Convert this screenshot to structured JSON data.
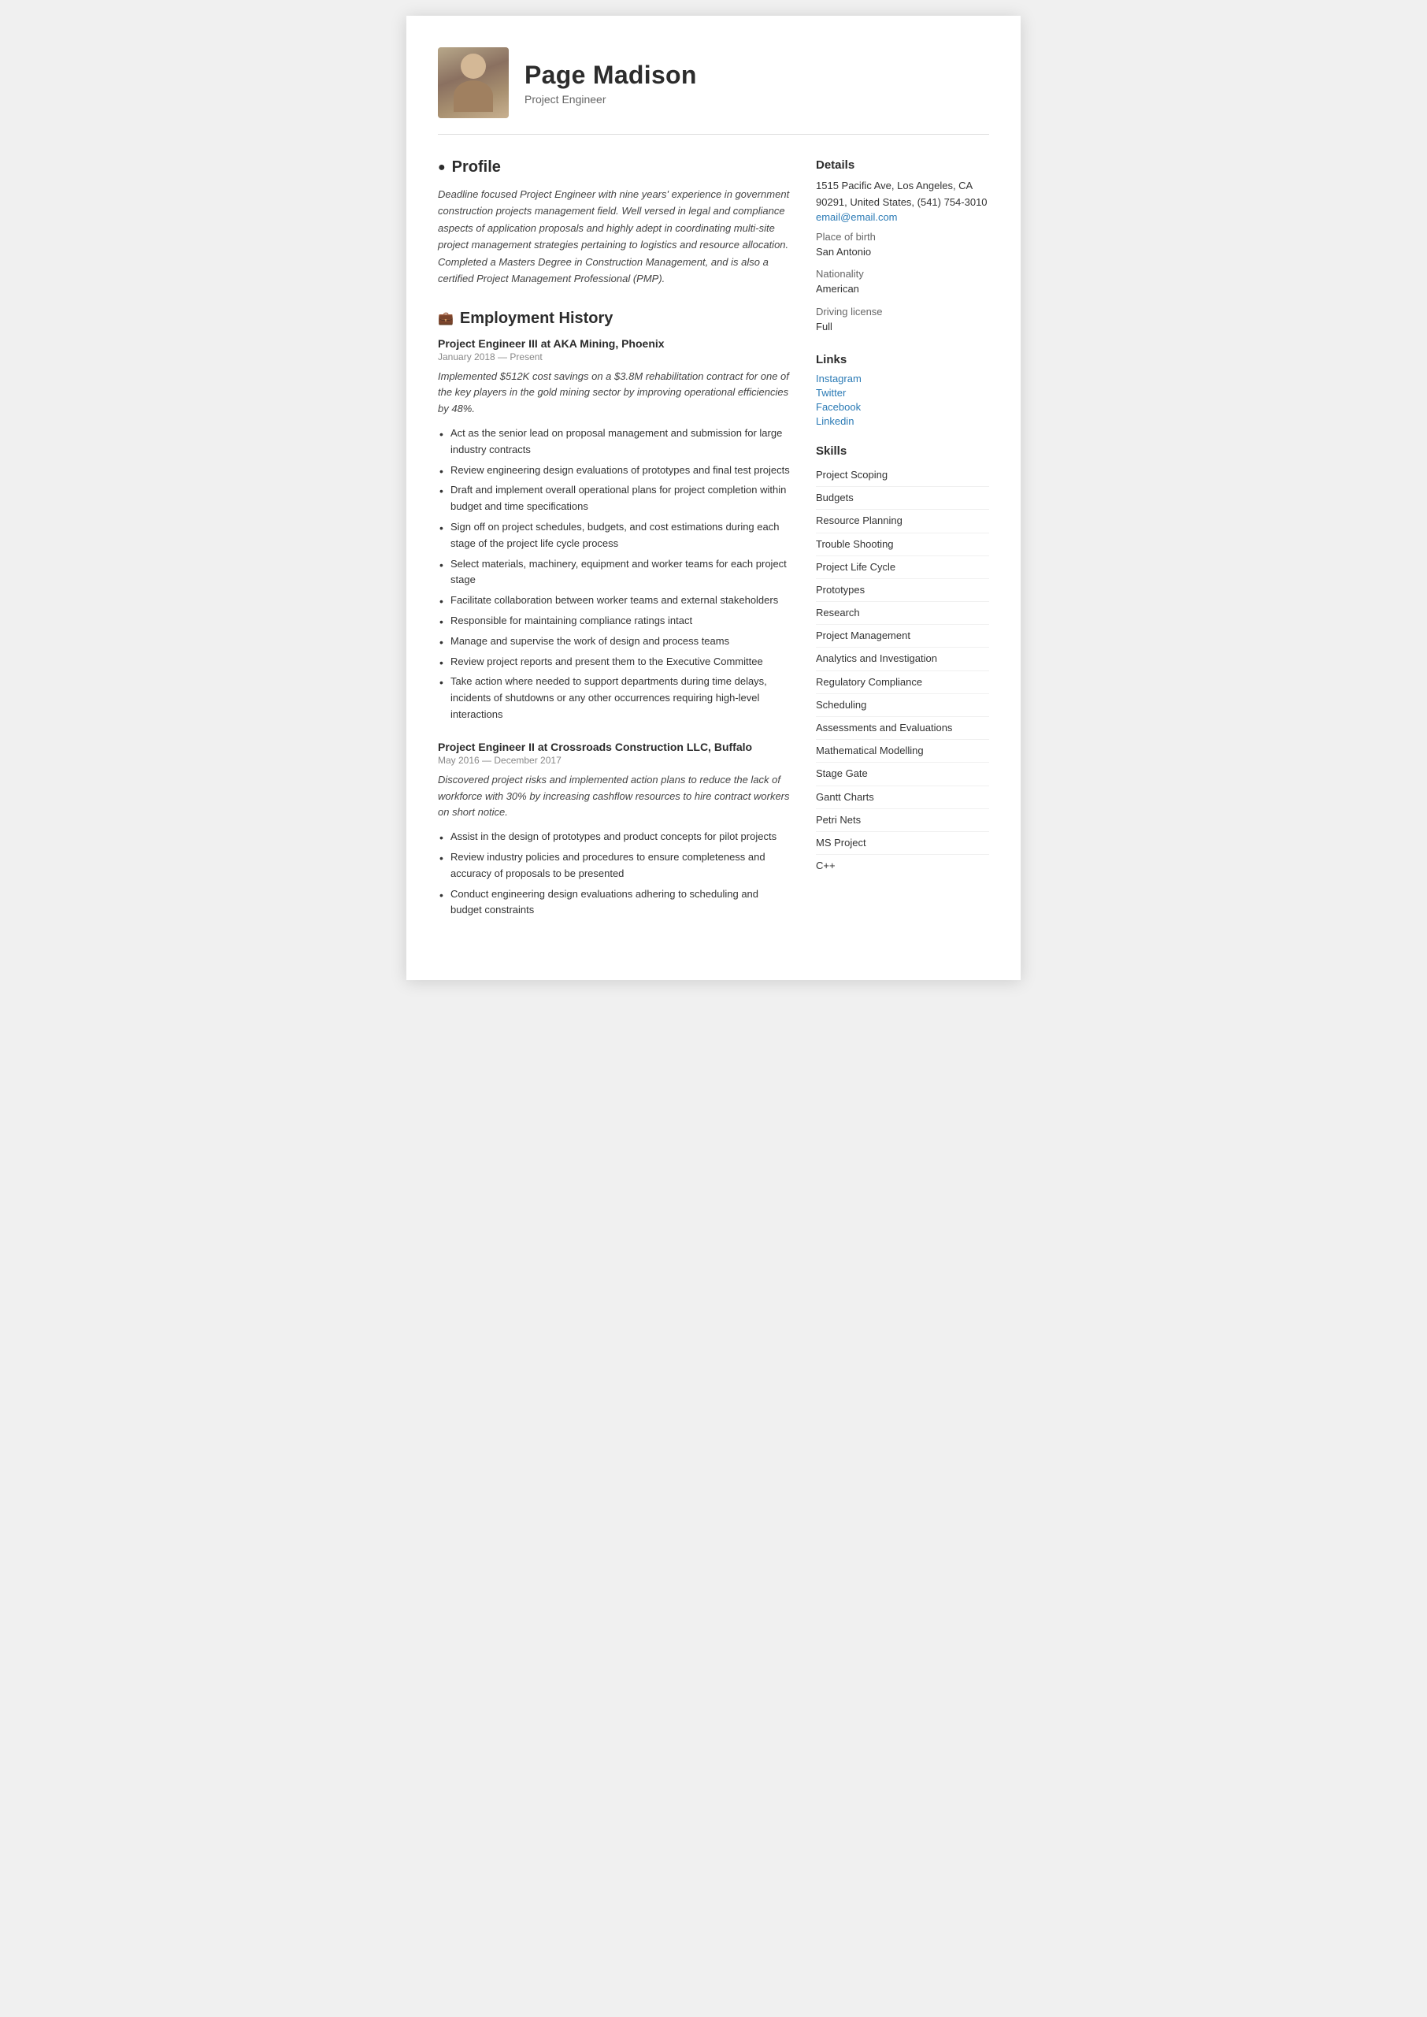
{
  "header": {
    "name": "Page Madison",
    "job_title": "Project Engineer"
  },
  "profile": {
    "section_title": "Profile",
    "text": "Deadline focused Project Engineer with nine years' experience in government construction projects management field. Well versed in legal and compliance aspects of application proposals and highly adept in coordinating multi-site project management strategies pertaining to logistics and resource allocation. Completed a Masters Degree in Construction Management, and is also a certified Project Management Professional (PMP)."
  },
  "employment": {
    "section_title": "Employment History",
    "jobs": [
      {
        "title": "Project Engineer III at  AKA Mining, Phoenix",
        "dates": "January 2018 — Present",
        "summary": "Implemented $512K cost savings on a $3.8M rehabilitation contract for one of the key players in the gold mining sector by improving operational efficiencies by 48%.",
        "bullets": [
          "Act as the senior lead on proposal management and submission for large industry contracts",
          "Review engineering design evaluations of prototypes and final test projects",
          "Draft and implement overall operational plans for project completion within budget and time specifications",
          "Sign off on project schedules, budgets, and cost estimations during each stage of the project life cycle process",
          "Select materials, machinery, equipment and worker teams for each project stage",
          "Facilitate collaboration between worker teams and external stakeholders",
          "Responsible for maintaining compliance ratings intact",
          "Manage and supervise the work of design and process teams",
          "Review project reports and present them to the Executive Committee",
          "Take action where needed to support departments during time delays, incidents of shutdowns or any other occurrences requiring high-level interactions"
        ]
      },
      {
        "title": "Project Engineer II at  Crossroads Construction LLC, Buffalo",
        "dates": "May 2016 — December 2017",
        "summary": "Discovered project risks and implemented action plans to reduce the lack of workforce with 30% by increasing cashflow resources to hire contract workers on short notice.",
        "bullets": [
          "Assist in the design of prototypes and product concepts for pilot projects",
          "Review industry policies and procedures to ensure completeness and accuracy of proposals to be presented",
          "Conduct engineering design evaluations adhering to scheduling and budget constraints"
        ]
      }
    ]
  },
  "details": {
    "section_title": "Details",
    "address": "1515 Pacific Ave, Los Angeles, CA 90291, United States, (541) 754-3010",
    "email": "email@email.com",
    "place_of_birth_label": "Place of birth",
    "place_of_birth": "San Antonio",
    "nationality_label": "Nationality",
    "nationality": "American",
    "driving_license_label": "Driving license",
    "driving_license": "Full"
  },
  "links": {
    "section_title": "Links",
    "items": [
      {
        "label": "Instagram",
        "url": "#"
      },
      {
        "label": "Twitter",
        "url": "#"
      },
      {
        "label": "Facebook",
        "url": "#"
      },
      {
        "label": "Linkedin",
        "url": "#"
      }
    ]
  },
  "skills": {
    "section_title": "Skills",
    "items": [
      "Project Scoping",
      "Budgets",
      "Resource Planning",
      "Trouble Shooting",
      "Project Life Cycle",
      "Prototypes",
      "Research",
      "Project Management",
      "Analytics and Investigation",
      "Regulatory Compliance",
      "Scheduling",
      "Assessments and Evaluations",
      "Mathematical Modelling",
      "Stage Gate",
      "Gantt Charts",
      "Petri Nets",
      "MS Project",
      "C++"
    ]
  }
}
